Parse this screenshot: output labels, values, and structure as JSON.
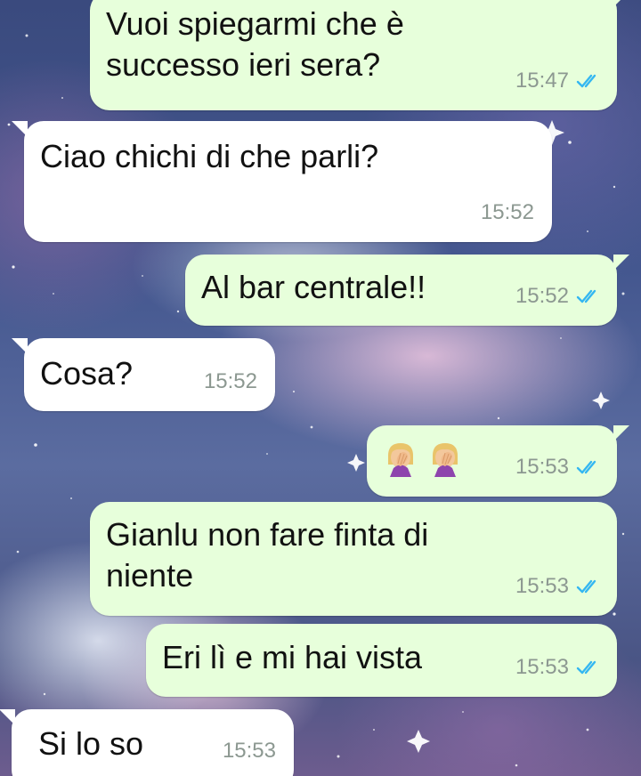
{
  "messages": [
    {
      "direction": "sent",
      "text": "Vuoi spiegarmi che è\nsuccesso ieri sera?",
      "time": "15:47",
      "status": "read"
    },
    {
      "direction": "received",
      "text": "Ciao chichi di che parli?",
      "time": "15:52"
    },
    {
      "direction": "sent",
      "text": "Al bar centrale!!",
      "time": "15:52",
      "status": "read"
    },
    {
      "direction": "received",
      "text": "Cosa?",
      "time": "15:52"
    },
    {
      "direction": "sent",
      "emoji": [
        "facepalm-woman",
        "facepalm-woman"
      ],
      "time": "15:53",
      "status": "read"
    },
    {
      "direction": "sent",
      "text": "Gianlu non fare finta di\nniente",
      "time": "15:53",
      "status": "read"
    },
    {
      "direction": "sent",
      "text": "Eri lì e mi hai vista",
      "time": "15:53",
      "status": "read"
    },
    {
      "direction": "received",
      "text": "Si lo so",
      "time": "15:53"
    }
  ],
  "colors": {
    "sent_bubble": "#e7ffdb",
    "received_bubble": "#ffffff",
    "read_ticks": "#34b7f1",
    "timestamp": "#8c9891"
  }
}
